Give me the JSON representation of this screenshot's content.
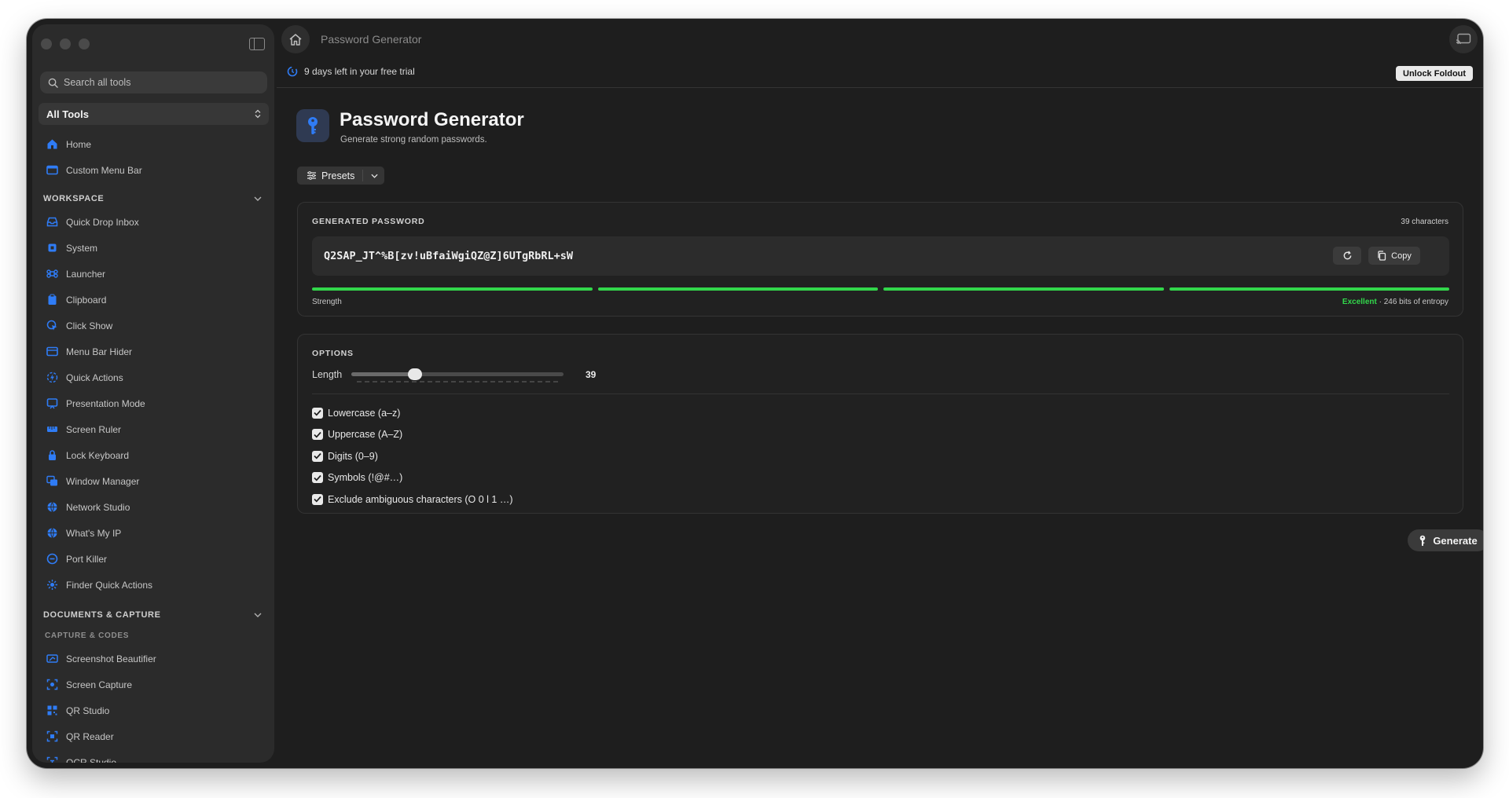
{
  "window": {
    "title": "Password Generator"
  },
  "sidebar": {
    "search_placeholder": "Search all tools",
    "scope_label": "All Tools",
    "top_items": [
      {
        "label": "Home",
        "icon": "house-icon"
      },
      {
        "label": "Custom Menu Bar",
        "icon": "menubar-icon"
      }
    ],
    "workspace_heading": "WORKSPACE",
    "workspace_items": [
      {
        "label": "Quick Drop Inbox",
        "icon": "tray-icon"
      },
      {
        "label": "System",
        "icon": "cpu-icon"
      },
      {
        "label": "Launcher",
        "icon": "command-icon"
      },
      {
        "label": "Clipboard",
        "icon": "clipboard-icon"
      },
      {
        "label": "Click Show",
        "icon": "pointer-icon"
      },
      {
        "label": "Menu Bar Hider",
        "icon": "menubar-hider-icon"
      },
      {
        "label": "Quick Actions",
        "icon": "bolt-icon"
      },
      {
        "label": "Presentation Mode",
        "icon": "presentation-icon"
      },
      {
        "label": "Screen Ruler",
        "icon": "ruler-icon"
      },
      {
        "label": "Lock Keyboard",
        "icon": "lock-icon"
      },
      {
        "label": "Window Manager",
        "icon": "windows-icon"
      },
      {
        "label": "Network Studio",
        "icon": "network-icon"
      },
      {
        "label": "What's My IP",
        "icon": "globe-icon"
      },
      {
        "label": "Port Killer",
        "icon": "port-icon"
      },
      {
        "label": "Finder Quick Actions",
        "icon": "finder-icon"
      }
    ],
    "documents_heading": "DOCUMENTS & CAPTURE",
    "capture_subheading": "CAPTURE & CODES",
    "capture_items": [
      {
        "label": "Screenshot Beautifier",
        "icon": "wand-icon"
      },
      {
        "label": "Screen Capture",
        "icon": "camera-icon"
      },
      {
        "label": "QR Studio",
        "icon": "qrcode-icon"
      },
      {
        "label": "QR Reader",
        "icon": "qr-scan-icon"
      },
      {
        "label": "OCR Studio",
        "icon": "text-scan-icon"
      }
    ]
  },
  "topbar": {
    "trial_text": "9 days left in your free trial",
    "unlock_label": "Unlock Foldout"
  },
  "header": {
    "title": "Password Generator",
    "subtitle": "Generate strong random passwords.",
    "presets_label": "Presets"
  },
  "generated": {
    "label": "GENERATED PASSWORD",
    "char_count": "39 characters",
    "password": "Q2SAP_JT^%B[zv!uBfaiWgiQZ@Z]6UTgRbRL+sW",
    "copy_label": "Copy",
    "strength_label": "Strength",
    "strength_rating": "Excellent",
    "entropy_text": "· 246 bits of entropy",
    "strength_segments_filled": 4,
    "strength_segments_total": 4
  },
  "options": {
    "label": "OPTIONS",
    "length_label": "Length",
    "length_value": "39",
    "length_fraction": 0.3,
    "checkboxes": [
      {
        "label": "Lowercase (a–z)",
        "checked": true
      },
      {
        "label": "Uppercase (A–Z)",
        "checked": true
      },
      {
        "label": "Digits (0–9)",
        "checked": true
      },
      {
        "label": "Symbols (!@#…)",
        "checked": true
      },
      {
        "label": "Exclude ambiguous characters (O 0 l 1 …)",
        "checked": true
      }
    ]
  },
  "actions": {
    "generate_label": "Generate"
  },
  "colors": {
    "accent": "#2f7cf6",
    "success": "#32d74b",
    "background": "#1e1e1e",
    "sidebar": "#2b2b2b"
  }
}
